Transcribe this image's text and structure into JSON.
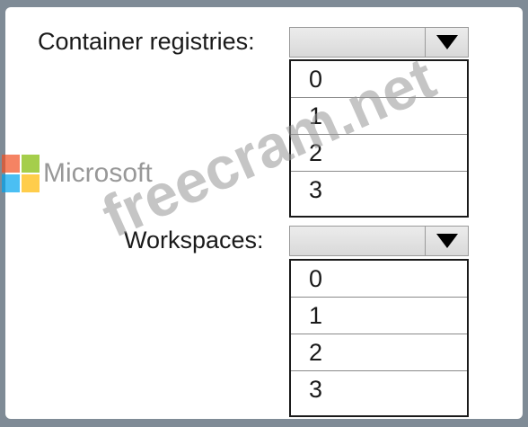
{
  "container_registries": {
    "label": "Container registries:",
    "selected": "",
    "options": [
      "0",
      "1",
      "2",
      "3"
    ]
  },
  "workspaces": {
    "label": "Workspaces:",
    "selected": "",
    "options": [
      "0",
      "1",
      "2",
      "3"
    ]
  },
  "logo": {
    "text": "Microsoft",
    "colors": [
      "#f25022",
      "#7fba00",
      "#00a4ef",
      "#ffb900"
    ]
  },
  "watermark": {
    "text": "freecram.net"
  },
  "icons": {
    "dropdown_arrow": "triangle-down-icon"
  }
}
